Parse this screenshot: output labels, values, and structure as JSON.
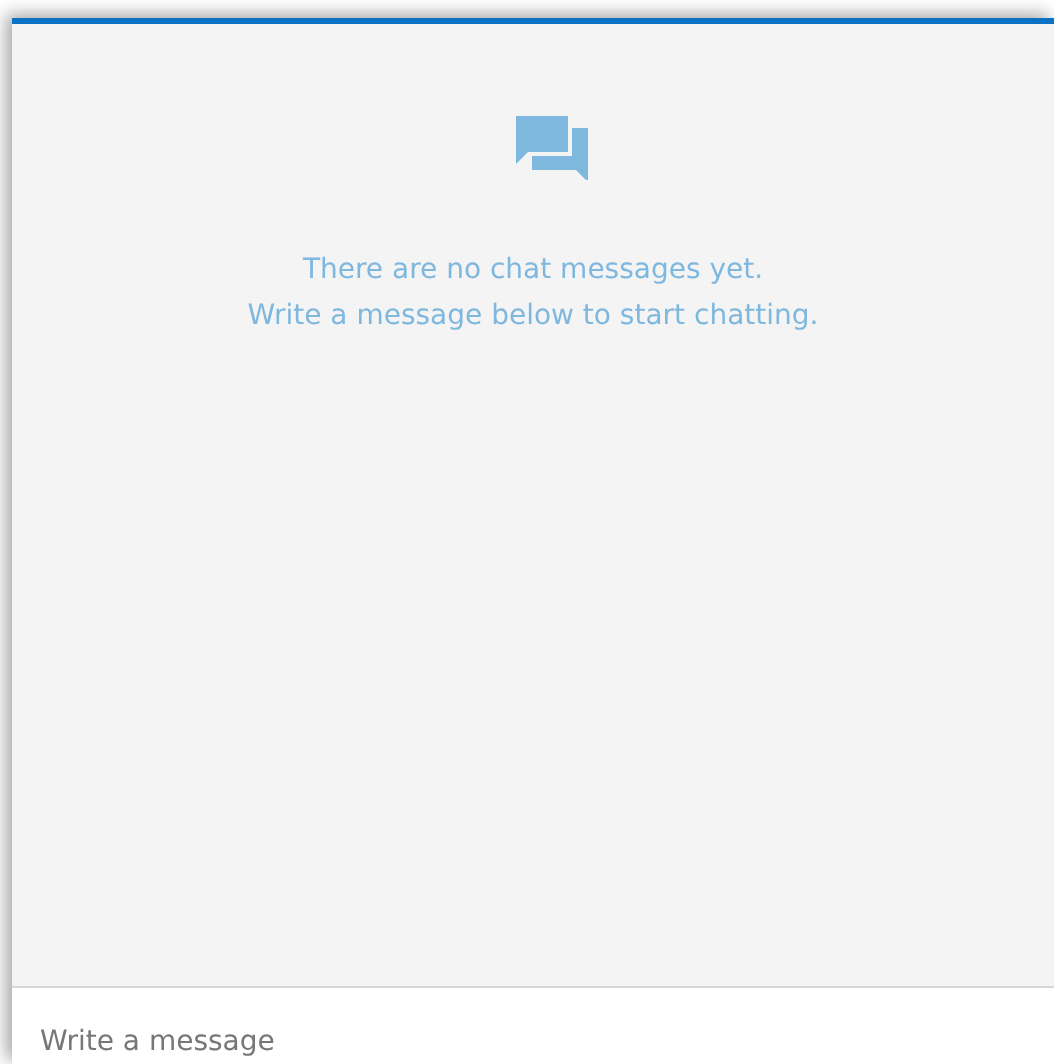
{
  "empty_state": {
    "lines": [
      "There are no chat messages yet.",
      "Write a message below to start chatting."
    ]
  },
  "composer": {
    "placeholder": "Write a message"
  }
}
